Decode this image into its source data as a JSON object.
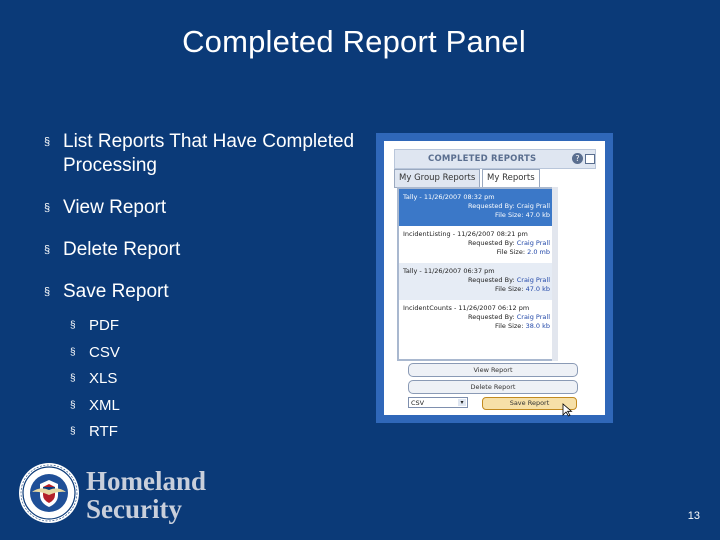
{
  "slide": {
    "title": "Completed Report Panel",
    "bullets": [
      "List Reports That Have Completed Processing",
      "View Report",
      "Delete Report",
      "Save Report"
    ],
    "bullet_mark": "§",
    "sub_bullets": [
      "PDF",
      "CSV",
      "XLS",
      "XML",
      "RTF"
    ],
    "page_number": "13"
  },
  "screenshot": {
    "panel_title": "COMPLETED REPORTS",
    "tabs": [
      "My Group Reports",
      "My Reports"
    ],
    "active_tab": "My Reports",
    "reports": [
      {
        "name": "Tally - 11/26/2007 08:32 pm",
        "requested_by_label": "Requested By:",
        "requested_by": "Craig Prall",
        "file_size_label": "File Size:",
        "file_size": "47.0 kb",
        "selected": true
      },
      {
        "name": "IncidentListing - 11/26/2007 08:21 pm",
        "requested_by_label": "Requested By:",
        "requested_by": "Craig Prall",
        "file_size_label": "File Size:",
        "file_size": "2.0 mb",
        "selected": false
      },
      {
        "name": "Tally - 11/26/2007 06:37 pm",
        "requested_by_label": "Requested By:",
        "requested_by": "Craig Prall",
        "file_size_label": "File Size:",
        "file_size": "47.0 kb",
        "selected": false
      },
      {
        "name": "IncidentCounts - 11/26/2007 06:12 pm",
        "requested_by_label": "Requested By:",
        "requested_by": "Craig Prall",
        "file_size_label": "File Size:",
        "file_size": "38.0 kb",
        "selected": false
      }
    ],
    "view_button": "View Report",
    "delete_button": "Delete Report",
    "format_select": "CSV",
    "save_button": "Save Report"
  },
  "footer": {
    "wordmark_line1": "Homeland",
    "wordmark_line2": "Security"
  },
  "colors": {
    "background": "#0b3a78",
    "screenshot_frame": "#2f67b9",
    "selected_row": "#3b78c8"
  },
  "icons": [
    "help-icon",
    "window-icon",
    "mouse-cursor-icon",
    "dhs-seal"
  ]
}
